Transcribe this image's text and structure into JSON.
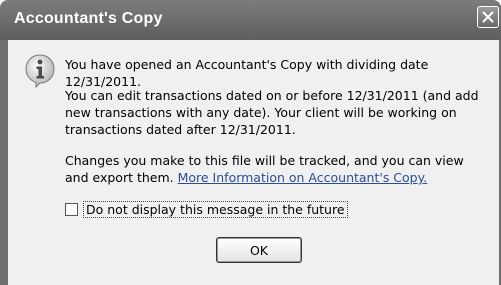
{
  "dialog": {
    "title": "Accountant's Copy",
    "icon": "info-icon",
    "message1": "You have opened an Accountant's Copy with dividing date 12/31/2011.",
    "message2": "You can edit transactions dated on or before 12/31/2011 (and add new transactions with any date). Your client will be working on transactions dated after 12/31/2011.",
    "message3_text": "Changes you make to this file will be tracked, and you can view and export them. ",
    "message3_link": "More Information on Accountant's Copy.",
    "checkbox_label": "Do not display this message in the future",
    "checkbox_checked": false,
    "ok_label": "OK"
  },
  "colors": {
    "titlebar": "#6e6e6e",
    "content_bg": "#f0f0f0",
    "link": "#2b4c9a"
  }
}
